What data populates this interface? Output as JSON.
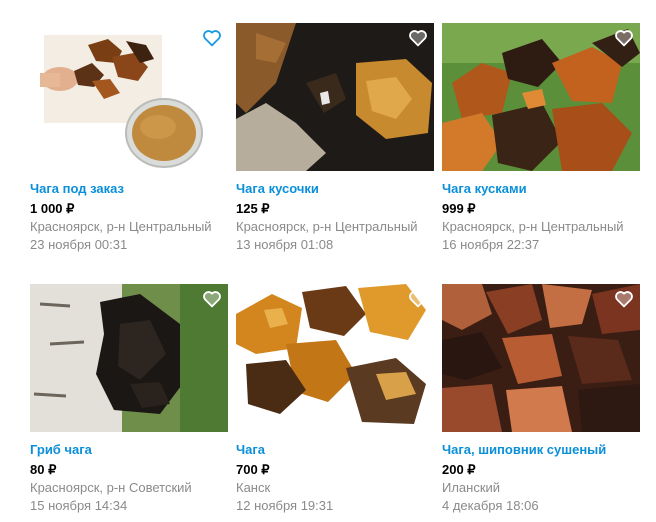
{
  "listings": [
    {
      "title": "Чага под заказ",
      "price": "1 000 ₽",
      "location": "Красноярск, р-н Центральный",
      "date": "23 ноября 00:31",
      "image": "chaga-powder-photo"
    },
    {
      "title": "Чага кусочки",
      "price": "125 ₽",
      "location": "Красноярск, р-н Центральный",
      "date": "13 ноября 01:08",
      "image": "chaga-on-tree-photo"
    },
    {
      "title": "Чага кусками",
      "price": "999 ₽",
      "location": "Красноярск, р-н Центральный",
      "date": "16 ноября 22:37",
      "image": "chaga-pile-photo"
    },
    {
      "title": "Гриб чага",
      "price": "80 ₽",
      "location": "Красноярск, р-н Советский",
      "date": "15 ноября 14:34",
      "image": "chaga-birch-photo"
    },
    {
      "title": "Чага",
      "price": "700 ₽",
      "location": "Канск",
      "date": "12 ноября 19:31",
      "image": "chaga-chunks-photo"
    },
    {
      "title": "Чага, шиповник сушеный",
      "price": "200 ₽",
      "location": "Иланский",
      "date": "4 декабря 18:06",
      "image": "chaga-dried-photo"
    }
  ],
  "colors": {
    "link": "#0a8fd9",
    "favorite": "#1a9ae0",
    "muted": "#8a8a8a"
  },
  "icons": {
    "favorite": "heart-outline-icon"
  }
}
